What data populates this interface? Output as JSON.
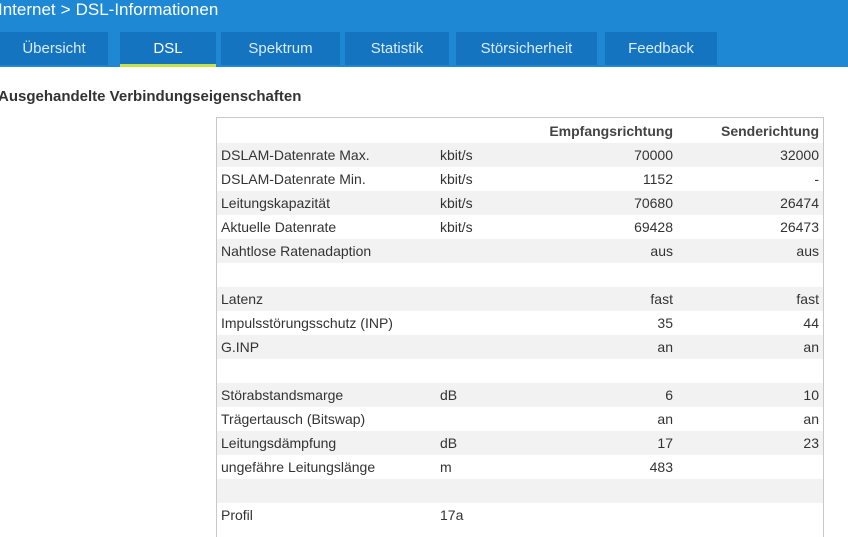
{
  "header": {
    "breadcrumb": [
      "Internet",
      "DSL-Informationen"
    ],
    "breadcrumb_separator": ">"
  },
  "tabs": [
    {
      "label": "Übersicht",
      "active": false
    },
    {
      "label": "DSL",
      "active": true
    },
    {
      "label": "Spektrum",
      "active": false
    },
    {
      "label": "Statistik",
      "active": false
    },
    {
      "label": "Störsicherheit",
      "active": false
    },
    {
      "label": "Feedback",
      "active": false
    }
  ],
  "section": {
    "title": "Ausgehandelte Verbindungseigenschaften"
  },
  "table": {
    "columns": {
      "label": "",
      "unit": "",
      "down": "Empfangsrichtung",
      "up": "Senderichtung"
    },
    "rows": [
      {
        "label": "DSLAM-Datenrate Max.",
        "unit": "kbit/s",
        "down": "70000",
        "up": "32000"
      },
      {
        "label": "DSLAM-Datenrate Min.",
        "unit": "kbit/s",
        "down": "1152",
        "up": "-"
      },
      {
        "label": "Leitungskapazität",
        "unit": "kbit/s",
        "down": "70680",
        "up": "26474"
      },
      {
        "label": "Aktuelle Datenrate",
        "unit": "kbit/s",
        "down": "69428",
        "up": "26473"
      },
      {
        "label": "Nahtlose Ratenadaption",
        "unit": "",
        "down": "aus",
        "up": "aus"
      },
      {
        "label": "",
        "unit": "",
        "down": "",
        "up": ""
      },
      {
        "label": "Latenz",
        "unit": "",
        "down": "fast",
        "up": "fast"
      },
      {
        "label": "Impulsstörungsschutz (INP)",
        "unit": "",
        "down": "35",
        "up": "44"
      },
      {
        "label": "G.INP",
        "unit": "",
        "down": "an",
        "up": "an"
      },
      {
        "label": "",
        "unit": "",
        "down": "",
        "up": ""
      },
      {
        "label": "Störabstandsmarge",
        "unit": "dB",
        "down": "6",
        "up": "10"
      },
      {
        "label": "Trägertausch (Bitswap)",
        "unit": "",
        "down": "an",
        "up": "an"
      },
      {
        "label": "Leitungsdämpfung",
        "unit": "dB",
        "down": "17",
        "up": "23"
      },
      {
        "label": "ungefähre Leitungslänge",
        "unit": "m",
        "down": "483",
        "up": ""
      },
      {
        "label": "",
        "unit": "",
        "down": "",
        "up": ""
      },
      {
        "label": "Profil",
        "unit": "17a",
        "down": "",
        "up": ""
      }
    ]
  },
  "colors": {
    "header_bg": "#1e88d4",
    "tab_bg": "#1574c0",
    "active_underline": "#c4e34b",
    "row_alt": "#f2f2f2"
  }
}
